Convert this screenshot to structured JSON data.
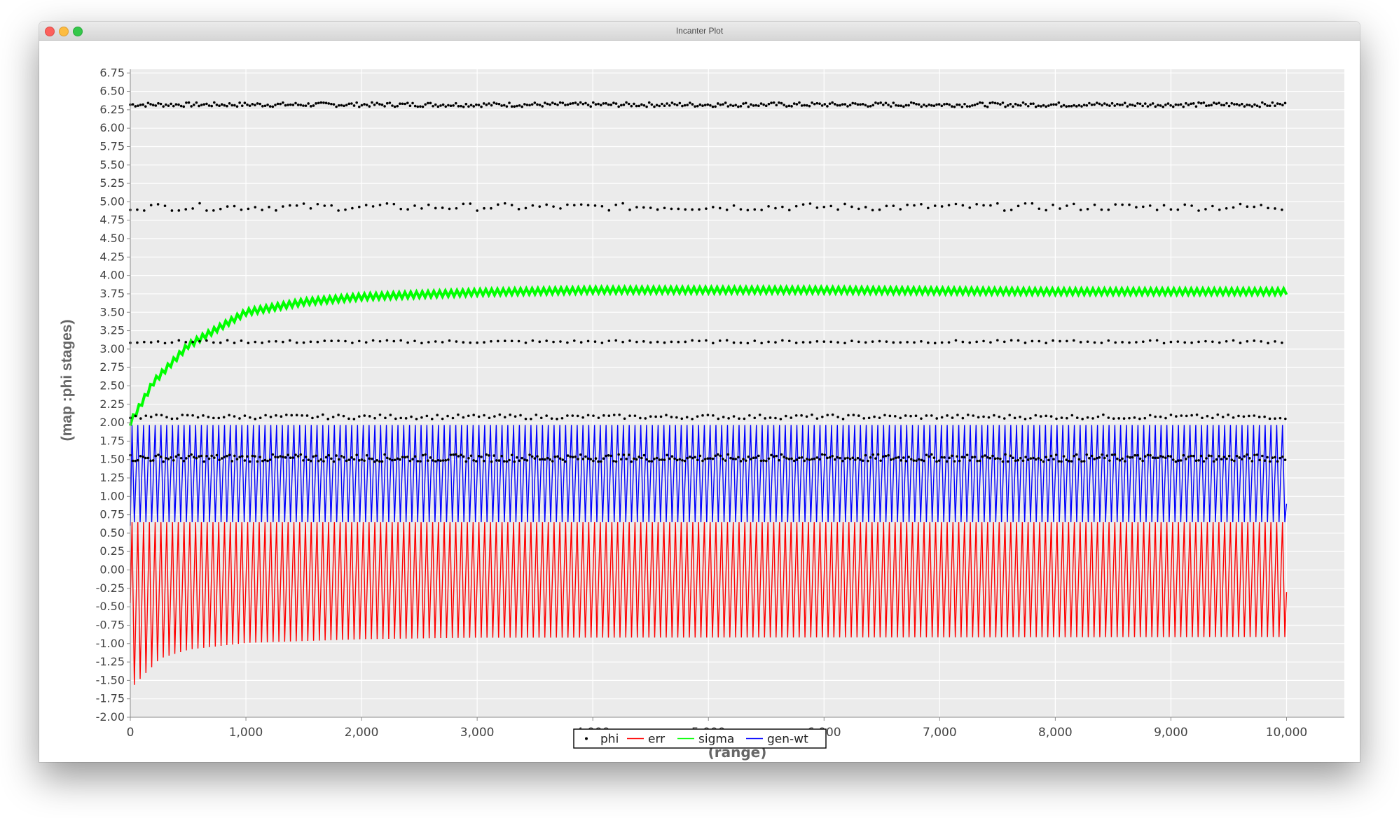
{
  "window": {
    "title": "Incanter Plot"
  },
  "chart_data": {
    "type": "line",
    "title": "",
    "xlabel": "(range)",
    "ylabel": "(map :phi stages)",
    "xlim": [
      0,
      10500
    ],
    "ylim": [
      -2.0,
      6.8
    ],
    "grid": true,
    "legend_position": "bottom",
    "x_ticks": [
      0,
      1000,
      2000,
      3000,
      4000,
      5000,
      6000,
      7000,
      8000,
      9000,
      10000
    ],
    "x_tick_labels": [
      "0",
      "1,000",
      "2,000",
      "3,000",
      "4,000",
      "5,000",
      "6,000",
      "7,000",
      "8,000",
      "9,000",
      "10,000"
    ],
    "y_ticks": [
      -2.0,
      -1.75,
      -1.5,
      -1.25,
      -1.0,
      -0.75,
      -0.5,
      -0.25,
      0.0,
      0.25,
      0.5,
      0.75,
      1.0,
      1.25,
      1.5,
      1.75,
      2.0,
      2.25,
      2.5,
      2.75,
      3.0,
      3.25,
      3.5,
      3.75,
      4.0,
      4.25,
      4.5,
      4.75,
      5.0,
      5.25,
      5.5,
      5.75,
      6.0,
      6.25,
      6.5,
      6.75
    ],
    "y_tick_labels": [
      "-2.00",
      "-1.75",
      "-1.50",
      "-1.25",
      "-1.00",
      "-0.75",
      "-0.50",
      "-0.25",
      "0.00",
      "0.25",
      "0.50",
      "0.75",
      "1.00",
      "1.25",
      "1.50",
      "1.75",
      "2.00",
      "2.25",
      "2.50",
      "2.75",
      "3.00",
      "3.25",
      "3.50",
      "3.75",
      "4.00",
      "4.25",
      "4.50",
      "4.75",
      "5.00",
      "5.25",
      "5.50",
      "5.75",
      "6.00",
      "6.25",
      "6.50",
      "6.75"
    ],
    "series": [
      {
        "name": "phi",
        "style": "points",
        "color": "#000000",
        "bands": [
          {
            "level": 6.32,
            "spread": 0.03,
            "density": "dense"
          },
          {
            "level": 4.93,
            "spread": 0.05,
            "density": "sparse"
          },
          {
            "level": 3.1,
            "spread": 0.02,
            "density": "sparse"
          },
          {
            "level": 2.08,
            "spread": 0.03,
            "density": "medium"
          },
          {
            "level": 1.52,
            "spread": 0.05,
            "density": "dense"
          }
        ]
      },
      {
        "name": "err",
        "style": "line",
        "color": "#ff0000",
        "oscillation": {
          "period": 50,
          "x_start": 0,
          "x_end": 10000,
          "upper": 0.65,
          "lower_envelope": [
            [
              0,
              -1.6
            ],
            [
              250,
              -1.2
            ],
            [
              500,
              -1.08
            ],
            [
              1000,
              -0.99
            ],
            [
              2000,
              -0.94
            ],
            [
              3000,
              -0.92
            ],
            [
              10000,
              -0.91
            ]
          ]
        }
      },
      {
        "name": "sigma",
        "style": "line",
        "color": "#00ff00",
        "curve": [
          [
            0,
            2.0
          ],
          [
            200,
            2.55
          ],
          [
            500,
            3.05
          ],
          [
            1000,
            3.5
          ],
          [
            1500,
            3.64
          ],
          [
            2000,
            3.71
          ],
          [
            3000,
            3.77
          ],
          [
            4000,
            3.8
          ],
          [
            6000,
            3.8
          ],
          [
            8000,
            3.78
          ],
          [
            10000,
            3.78
          ]
        ],
        "band_halfwidth": 0.04
      },
      {
        "name": "gen-wt",
        "style": "line",
        "color": "#0000ff",
        "oscillation": {
          "period": 50,
          "x_start": 0,
          "x_end": 10000,
          "upper": 1.97,
          "lower": 0.65,
          "end_value": 0.9
        }
      }
    ]
  }
}
